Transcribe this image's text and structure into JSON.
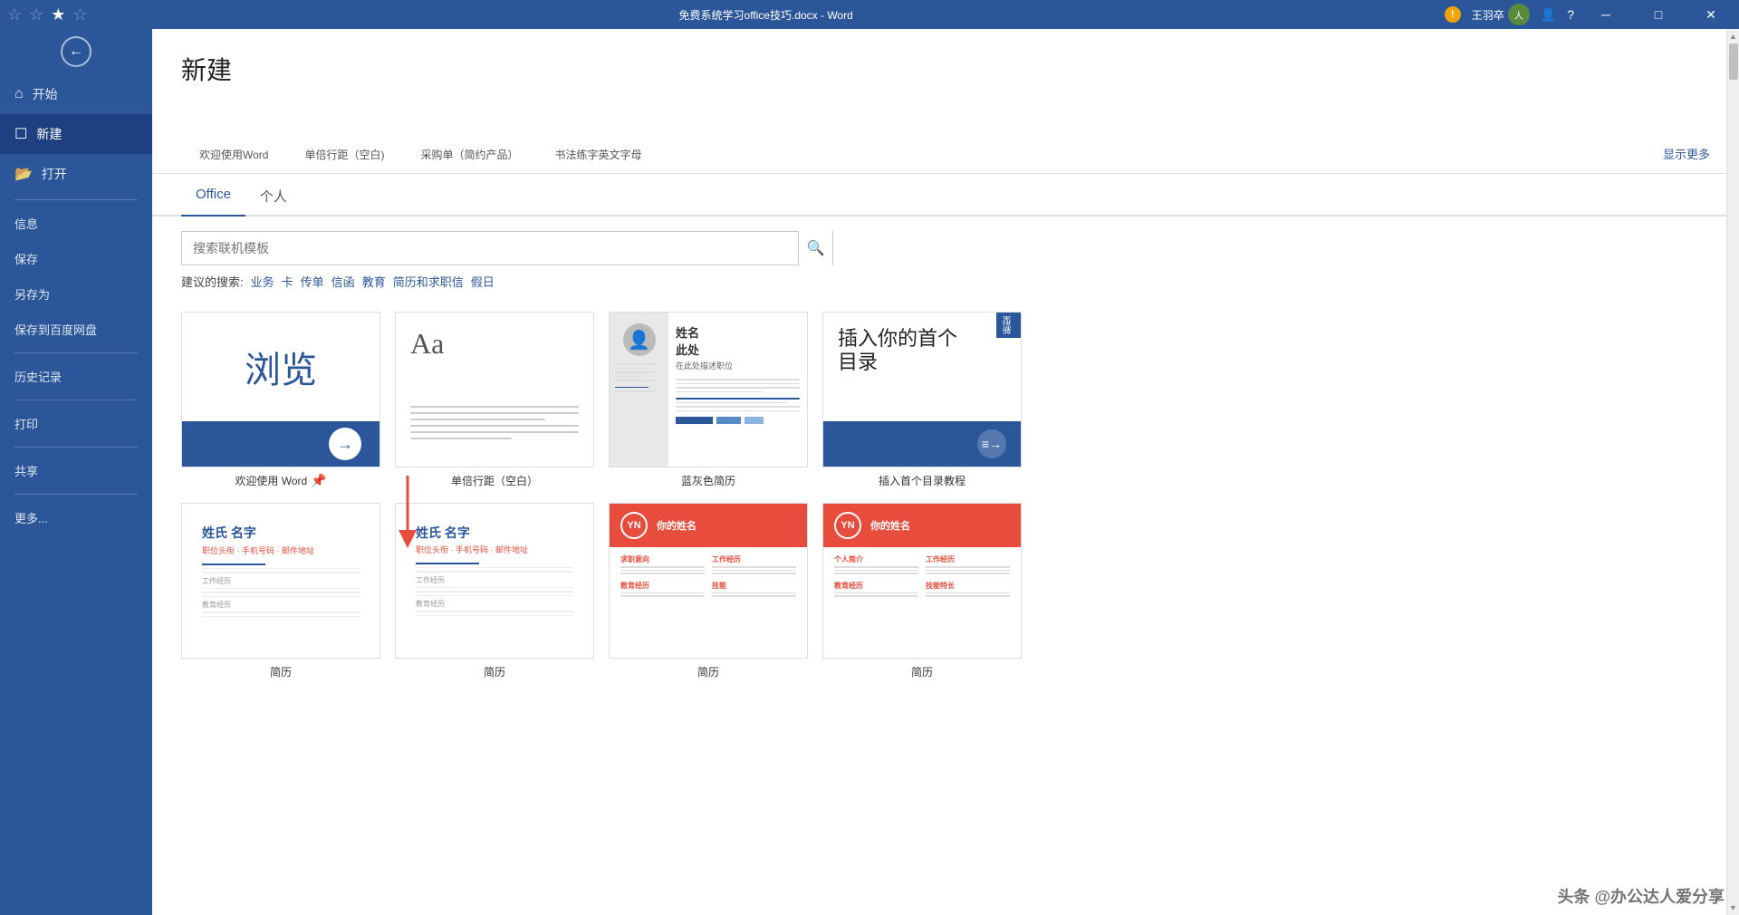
{
  "titlebar": {
    "title": "免费系统学习office技巧.docx - Word",
    "minimize": "─",
    "maximize": "□",
    "close": "✕"
  },
  "sidebar": {
    "back_label": "‹",
    "items": [
      {
        "id": "home",
        "icon": "⌂",
        "label": "开始"
      },
      {
        "id": "new",
        "icon": "☐",
        "label": "新建",
        "active": true
      },
      {
        "id": "open",
        "icon": "📂",
        "label": "打开"
      }
    ],
    "text_items": [
      {
        "id": "info",
        "label": "信息"
      },
      {
        "id": "save",
        "label": "保存"
      },
      {
        "id": "save-as",
        "label": "另存为"
      },
      {
        "id": "save-baidu",
        "label": "保存到百度网盘"
      },
      {
        "id": "history",
        "label": "历史记录"
      },
      {
        "id": "print",
        "label": "打印"
      },
      {
        "id": "share",
        "label": "共享"
      },
      {
        "id": "more",
        "label": "更多..."
      }
    ]
  },
  "page": {
    "title": "新建",
    "show_more": "显示更多",
    "tabs": [
      {
        "id": "office",
        "label": "Office",
        "active": true
      },
      {
        "id": "personal",
        "label": "个人"
      }
    ],
    "search": {
      "placeholder": "搜索联机模板",
      "button_icon": "🔍"
    },
    "suggested": {
      "label": "建议的搜索:",
      "items": [
        "业务",
        "卡",
        "传单",
        "信函",
        "教育",
        "简历和求职信",
        "假日"
      ]
    },
    "strip_items": [
      {
        "label": "欢迎使用Word"
      },
      {
        "label": "单倍行距（空白)"
      },
      {
        "label": "采购单（简约产品）"
      },
      {
        "label": "书法练字英文字母"
      }
    ]
  },
  "templates": {
    "row1": [
      {
        "id": "welcome",
        "label": "欢迎使用 Word",
        "type": "welcome",
        "pinnable": true
      },
      {
        "id": "blank",
        "label": "单倍行距（空白）",
        "type": "blank",
        "pinnable": false
      },
      {
        "id": "resume-blue",
        "label": "蓝灰色简历",
        "type": "resume",
        "pinnable": false
      },
      {
        "id": "toc",
        "label": "插入首个目录教程",
        "type": "toc",
        "new": true,
        "pinnable": false
      }
    ],
    "row2": [
      {
        "id": "resume2a",
        "label": "简历",
        "type": "resume2a",
        "pinnable": false
      },
      {
        "id": "resume2b",
        "label": "简历",
        "type": "resume2b",
        "pinnable": false
      },
      {
        "id": "resume-yn1",
        "label": "简历",
        "type": "yn1",
        "pinnable": false
      },
      {
        "id": "resume-yn2",
        "label": "简历",
        "type": "yn2",
        "pinnable": false
      }
    ]
  },
  "watermark": {
    "text": "头条 @办公达人爱分享"
  }
}
